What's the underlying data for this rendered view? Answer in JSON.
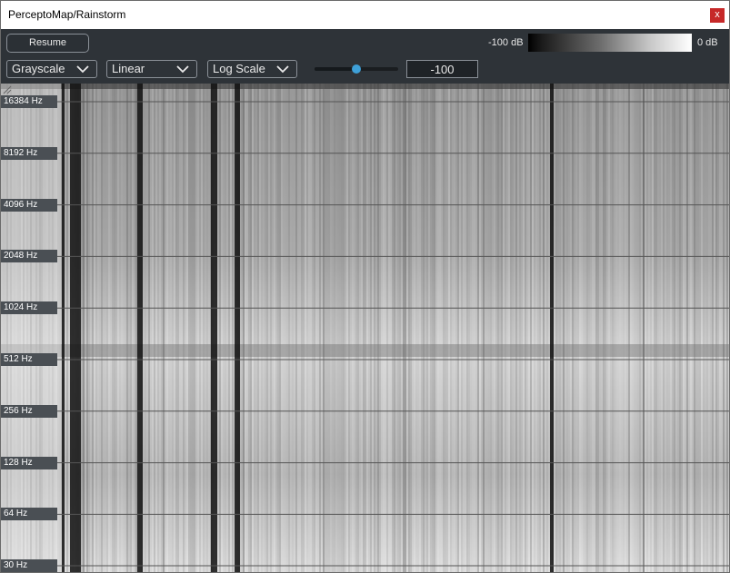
{
  "window": {
    "title": "PerceptoMap/Rainstorm",
    "close_label": "x"
  },
  "toolbar": {
    "resume_label": "Resume",
    "db_min_label": "-100 dB",
    "db_max_label": "0 dB",
    "colormap_selected": "Grayscale",
    "freq_mode_selected": "Linear",
    "scale_selected": "Log Scale",
    "floor_slider_value_fraction": 0.5,
    "floor_value": "-100"
  },
  "spectrogram": {
    "freq_labels": [
      "16384 Hz",
      "8192 Hz",
      "4096 Hz",
      "2048 Hz",
      "1024 Hz",
      "512 Hz",
      "256 Hz",
      "128 Hz",
      "64 Hz",
      "30 Hz"
    ],
    "colors": {
      "background": "#c8c8c8",
      "gridline": "#555555",
      "silent_band": "#111111"
    }
  }
}
